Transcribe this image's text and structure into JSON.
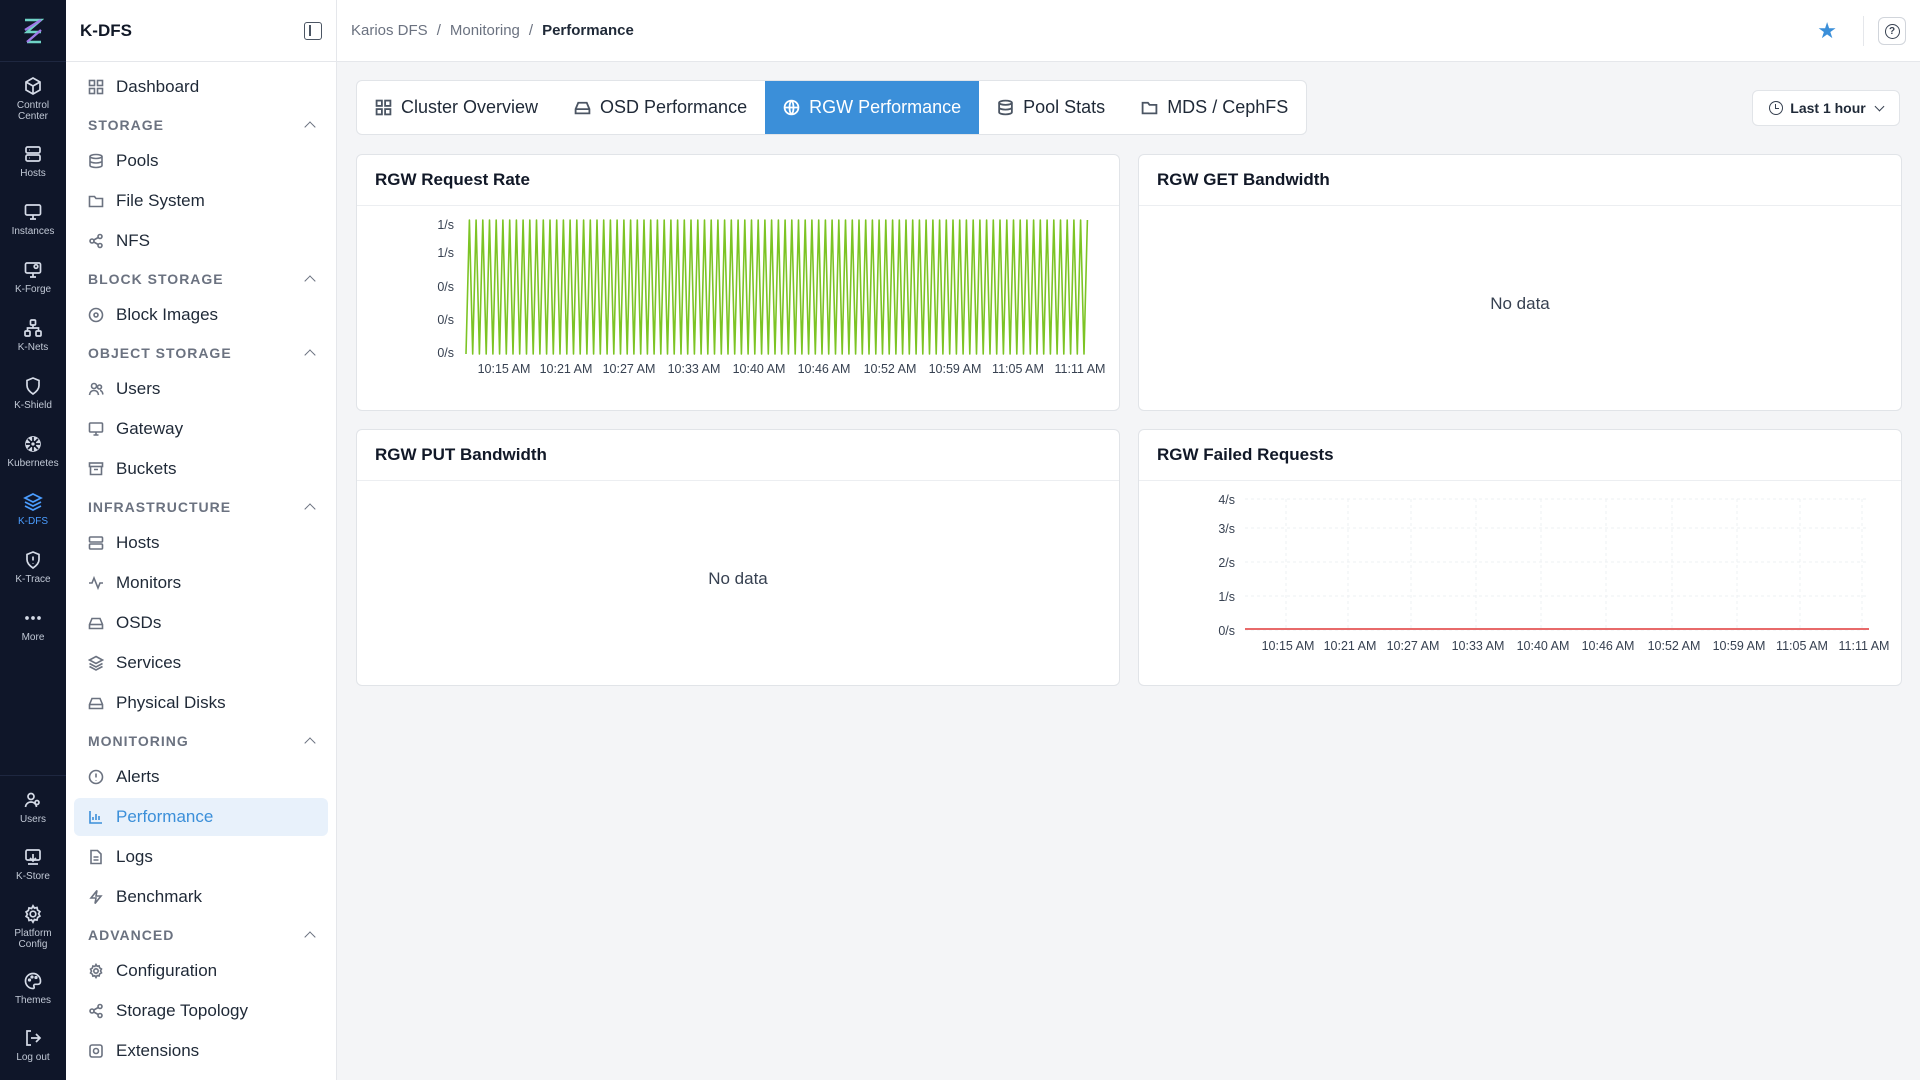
{
  "rail": {
    "top": [
      {
        "label": "Control\nCenter",
        "icon": "cube-icon"
      },
      {
        "label": "Hosts",
        "icon": "server-icon"
      },
      {
        "label": "Instances",
        "icon": "monitor-icon"
      },
      {
        "label": "K-Forge",
        "icon": "monitor-gear-icon"
      },
      {
        "label": "K-Nets",
        "icon": "network-icon"
      },
      {
        "label": "K-Shield",
        "icon": "shield-icon"
      },
      {
        "label": "Kubernetes",
        "icon": "helm-icon"
      },
      {
        "label": "K-DFS",
        "icon": "layers-icon",
        "active": true
      },
      {
        "label": "K-Trace",
        "icon": "shield-alert-icon"
      },
      {
        "label": "More",
        "icon": "more-icon"
      }
    ],
    "bottom": [
      {
        "label": "Users",
        "icon": "users-icon"
      },
      {
        "label": "K-Store",
        "icon": "store-icon"
      },
      {
        "label": "Platform\nConfig",
        "icon": "gear-icon"
      },
      {
        "label": "Themes",
        "icon": "palette-icon"
      },
      {
        "label": "Log out",
        "icon": "logout-icon"
      }
    ]
  },
  "sidebar": {
    "title": "K-DFS",
    "dashboard": "Dashboard",
    "sections": {
      "storage": {
        "title": "STORAGE",
        "items": [
          "Pools",
          "File System",
          "NFS"
        ]
      },
      "block": {
        "title": "BLOCK STORAGE",
        "items": [
          "Block Images"
        ]
      },
      "object": {
        "title": "OBJECT STORAGE",
        "items": [
          "Users",
          "Gateway",
          "Buckets"
        ]
      },
      "infra": {
        "title": "INFRASTRUCTURE",
        "items": [
          "Hosts",
          "Monitors",
          "OSDs",
          "Services",
          "Physical Disks"
        ]
      },
      "monitoring": {
        "title": "MONITORING",
        "items": [
          "Alerts",
          "Performance",
          "Logs",
          "Benchmark"
        ]
      },
      "advanced": {
        "title": "ADVANCED",
        "items": [
          "Configuration",
          "Storage Topology",
          "Extensions"
        ]
      }
    }
  },
  "breadcrumb": [
    "Karios DFS",
    "Monitoring",
    "Performance"
  ],
  "tabs": [
    "Cluster Overview",
    "OSD Performance",
    "RGW Performance",
    "Pool Stats",
    "MDS / CephFS"
  ],
  "time_range": "Last 1 hour",
  "colors": {
    "accent": "#3b8fd9",
    "request_rate": "#7cc424",
    "failed": "#e86a6a"
  },
  "panels": {
    "request_rate": {
      "title": "RGW Request Rate"
    },
    "get_bw": {
      "title": "RGW GET Bandwidth",
      "empty": "No data"
    },
    "put_bw": {
      "title": "RGW PUT Bandwidth",
      "empty": "No data"
    },
    "failed": {
      "title": "RGW Failed Requests"
    }
  },
  "chart_data": [
    {
      "type": "line",
      "title": "RGW Request Rate",
      "y_tick_labels": [
        "1/s",
        "1/s",
        "0/s",
        "0/s",
        "0/s"
      ],
      "x_tick_labels": [
        "10:15 AM",
        "10:21 AM",
        "10:27 AM",
        "10:33 AM",
        "10:40 AM",
        "10:46 AM",
        "10:52 AM",
        "10:59 AM",
        "11:05 AM",
        "11:11 AM"
      ],
      "ylim": [
        0,
        0.8
      ],
      "series": [
        {
          "values": "oscillating between 0 and ~0.8 req/s, about 90 cycles"
        }
      ],
      "grid": false
    },
    {
      "type": "line",
      "title": "RGW Failed Requests",
      "y_tick_labels": [
        "4/s",
        "3/s",
        "2/s",
        "1/s",
        "0/s"
      ],
      "x_tick_labels": [
        "10:15 AM",
        "10:21 AM",
        "10:27 AM",
        "10:33 AM",
        "10:40 AM",
        "10:46 AM",
        "10:52 AM",
        "10:59 AM",
        "11:05 AM",
        "11:11 AM"
      ],
      "ylim": [
        0,
        4
      ],
      "series": [
        {
          "values": [
            0,
            0,
            0,
            0,
            0,
            0,
            0,
            0,
            0,
            0
          ]
        }
      ],
      "grid": true
    }
  ]
}
